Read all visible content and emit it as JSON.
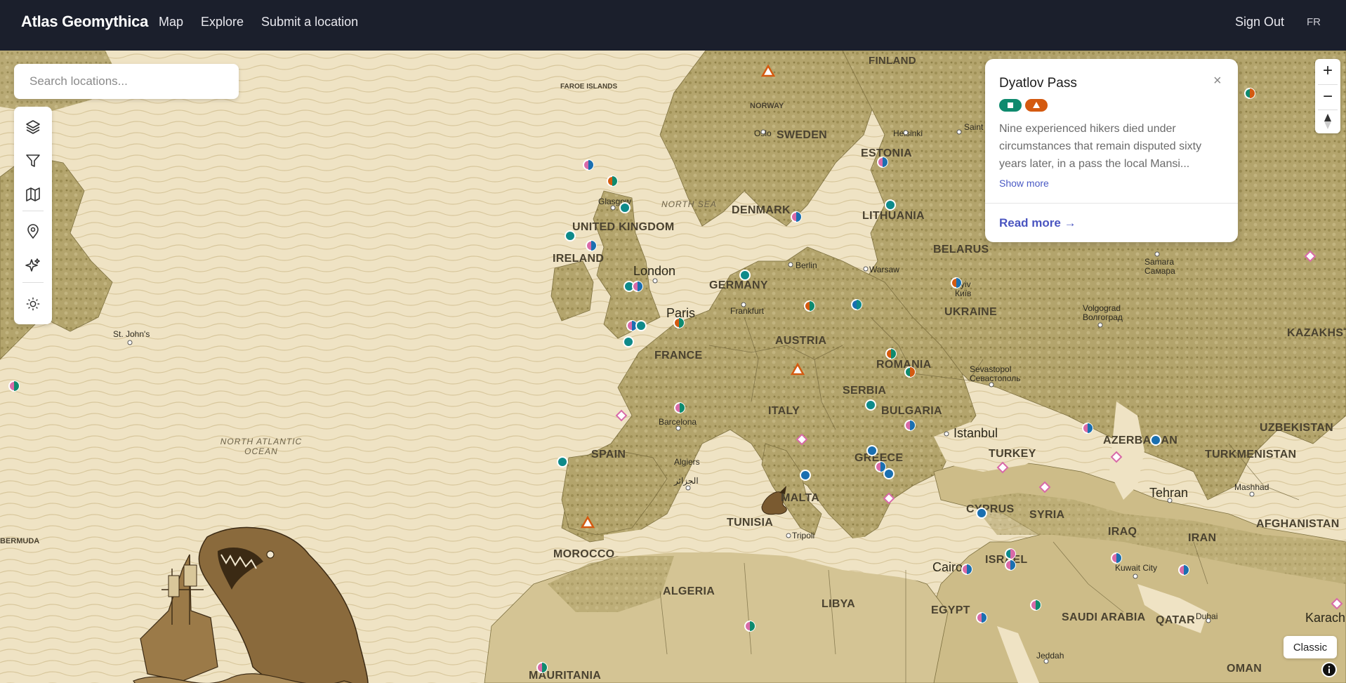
{
  "header": {
    "brand": "Atlas Geomythica",
    "nav": [
      "Map",
      "Explore",
      "Submit a location"
    ],
    "sign_out": "Sign Out",
    "language": "FR"
  },
  "search": {
    "placeholder": "Search locations..."
  },
  "toolbar": {
    "icons": [
      "layers-icon",
      "filter-icon",
      "map-icon",
      "pin-icon",
      "sparkles-icon",
      "sun-icon"
    ]
  },
  "popup": {
    "title": "Dyatlov Pass",
    "close": "×",
    "badges": [
      {
        "icon": "square-icon",
        "color": "#0e8a6e"
      },
      {
        "icon": "triangle-icon",
        "color": "#d45a10"
      }
    ],
    "description": "Nine experienced hikers died under circumstances that remain disputed sixty years later, in a pass the local Mansi...",
    "show_more": "Show more",
    "read_more": "Read more →"
  },
  "map_controls": {
    "zoom_in": "+",
    "zoom_out": "−",
    "style_toggle": "Classic"
  },
  "map_labels": {
    "countries": [
      "FINLAND",
      "SWEDEN",
      "NORWAY",
      "ESTONIA",
      "LITHUANIA",
      "DENMARK",
      "UNITED KINGDOM",
      "IRELAND",
      "GERMANY",
      "BELARUS",
      "UKRAINE",
      "FRANCE",
      "AUSTRIA",
      "ROMANIA",
      "SERBIA",
      "BULGARIA",
      "ITALY",
      "SPAIN",
      "GREECE",
      "TURKEY",
      "MALTA",
      "TUNISIA",
      "MOROCCO",
      "ALGERIA",
      "LIBYA",
      "EGYPT",
      "CYPRUS",
      "SYRIA",
      "IRAQ",
      "IRAN",
      "ISRAEL",
      "SAUDI ARABIA",
      "QATAR",
      "OMAN",
      "MAURITANIA",
      "AZERBAIJAN",
      "TURKMENISTAN",
      "UZBEKISTAN",
      "KAZAKHSTAN",
      "AFGHANISTAN",
      "BERMUDA"
    ],
    "cities": [
      "Oslo",
      "Helsinki",
      "Saint",
      "Glasgow",
      "Berlin",
      "Warsaw",
      "Frankfurt",
      "Samara",
      "Самара",
      "Kyiv",
      "Київ",
      "Volgograd",
      "Волгоград",
      "Sevastopol",
      "Севастополь",
      "Barcelona",
      "Algiers",
      "الجزائر",
      "Istanbul",
      "Tripoli",
      "Cairo",
      "Kuwait City",
      "Dubai",
      "Jeddah",
      "Mashhad",
      "Tehran",
      "Karachi",
      "St. John's",
      "London",
      "Paris"
    ],
    "seas": [
      "NORTH SEA",
      "NORTH ATLANTIC OCEAN",
      "FAROE ISLANDS"
    ]
  },
  "colors": {
    "header_bg": "#1b1f2c",
    "sea": "#efe3c4",
    "land": "#b7a872",
    "accent_link": "#4a55c0",
    "marker_teal": "#0e8a8a",
    "marker_orange": "#d45a10",
    "marker_pink": "#d86aa8",
    "marker_blue": "#1a6fb0"
  }
}
